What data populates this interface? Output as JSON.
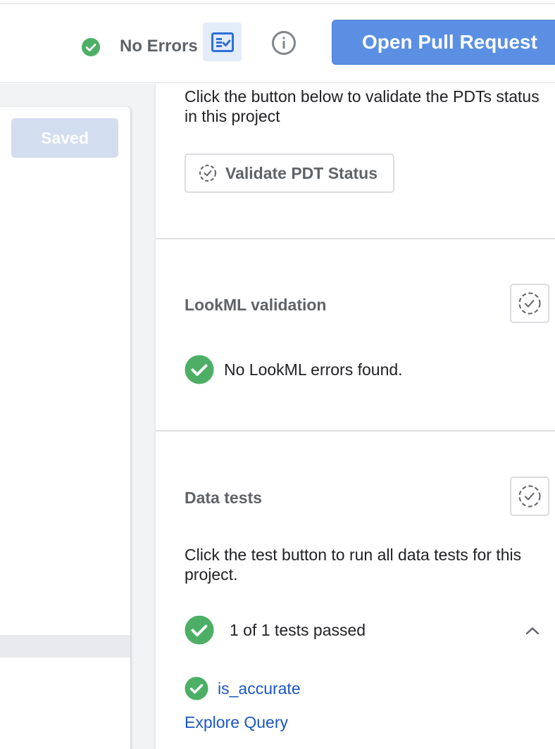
{
  "header": {
    "status_text": "No Errors",
    "status_icon": "check-circle-icon",
    "validate_toggle_icon": "checklist-icon",
    "info_icon": "info-icon",
    "pull_request_label": "Open Pull Request"
  },
  "editor": {
    "saved_label": "Saved"
  },
  "pdt": {
    "description": "Click the button below to validate the PDTs status in this project",
    "button_label": "Validate PDT Status"
  },
  "lookml": {
    "title": "LookML validation",
    "result": "No LookML errors found."
  },
  "data_tests": {
    "title": "Data tests",
    "description": "Click the test button to run all data tests for this project.",
    "summary": "1 of 1 tests passed",
    "test_name": "is_accurate",
    "explore_link": "Explore Query"
  },
  "colors": {
    "success": "#4caf65",
    "primary": "#5a8fe3",
    "link": "#1a56c4"
  }
}
